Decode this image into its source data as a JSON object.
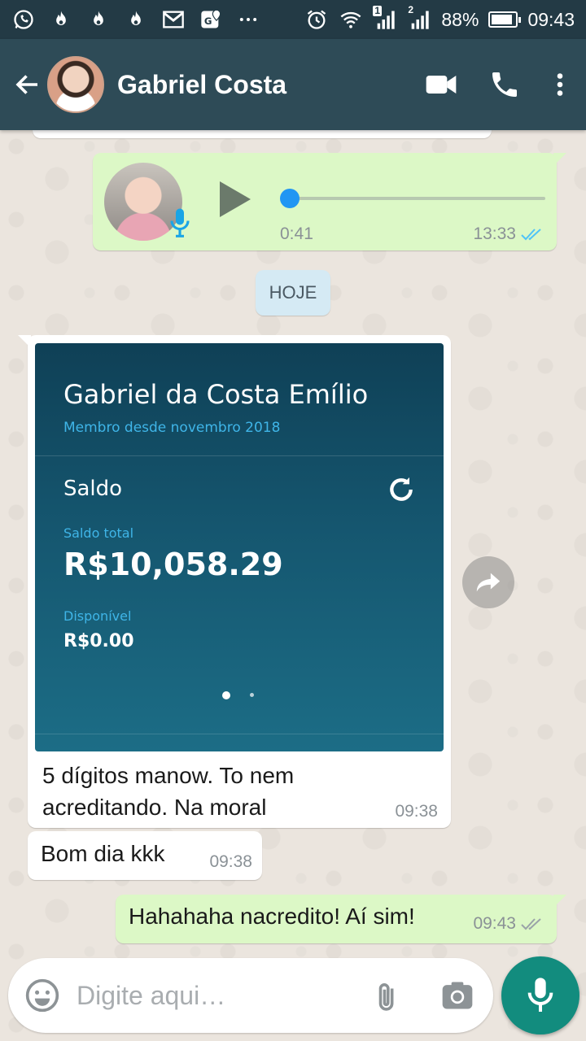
{
  "status_bar": {
    "battery": "88%",
    "battery_level": 0.88,
    "time": "09:43",
    "sim1_badge": "1",
    "sim2_badge": "2",
    "icons": [
      "whatsapp-icon",
      "flame-icon",
      "flame-icon",
      "flame-icon",
      "gmail-icon",
      "maps-icon",
      "more-dots-icon",
      "alarm-icon",
      "wifi-icon",
      "signal-icon",
      "signal-icon",
      "battery-icon"
    ]
  },
  "header": {
    "contact_name": "Gabriel Costa",
    "actions": [
      "video-call-icon",
      "phone-icon",
      "more-vert-icon"
    ]
  },
  "messages": {
    "voice": {
      "duration": "0:41",
      "time": "13:33",
      "status": "read",
      "progress": 0.0
    },
    "date_chip": "HOJE",
    "image_message": {
      "card": {
        "name": "Gabriel da Costa Emílio",
        "member_since": "Membro desde novembro 2018",
        "balance_section": "Saldo",
        "total_label": "Saldo total",
        "total_value": "R$10,058.29",
        "available_label": "Disponível",
        "available_value": "R$0.00"
      },
      "caption": "5 dígitos manow. To nem acreditando. Na moral",
      "time": "09:38"
    },
    "bom_dia": {
      "text": "Bom dia kkk",
      "time": "09:38"
    },
    "outgoing_last": {
      "text": "Hahahaha nacredito! Aí sim!",
      "time": "09:43",
      "status": "read"
    }
  },
  "composer": {
    "placeholder": "Digite aqui…"
  },
  "colors": {
    "app_bar": "#2e4b57",
    "status_bar": "#233a45",
    "outgoing_bubble": "#dcf8c6",
    "incoming_bubble": "#ffffff",
    "accent": "#128c7e",
    "read_tick": "#4fc3f7"
  }
}
